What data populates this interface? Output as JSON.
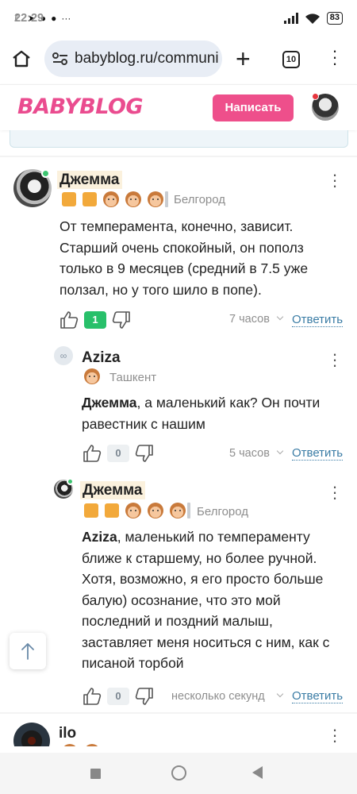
{
  "status_bar": {
    "time": "22:29",
    "battery": "83"
  },
  "browser": {
    "url": "babyblog.ru/communi",
    "tab_count": "10"
  },
  "site": {
    "logo": "BABYBLOG",
    "write_button": "Написать"
  },
  "comments": [
    {
      "name": "Джемма",
      "city": "Белгород",
      "text": "От темперамента, конечно, зависит. Старший очень спокойный, он пополз только в 9 месяцев (средний в 7.5 уже ползал, но у того шило в попе).",
      "votes": "1",
      "time": "7 часов",
      "reply": "Ответить"
    },
    {
      "name": "Aziza",
      "city": "Ташкент",
      "mention": "Джемма",
      "text": ", а маленький как? Он почти равестник с нашим",
      "votes": "0",
      "time": "5 часов",
      "reply": "Ответить"
    },
    {
      "name": "Джемма",
      "city": "Белгород",
      "mention": "Aziza",
      "text": ", маленький по темпераменту ближе к старшему, но более ручной. Хотя, возможно, я его просто больше балую) осознание, что это мой последний и поздний малыш, заставляет меня носиться с ним, как с писаной торбой",
      "votes": "0",
      "time": "несколько секунд",
      "reply": "Ответить"
    },
    {
      "name": "ilo"
    }
  ],
  "colors": {
    "accent": "#ee4f8b",
    "link": "#3a7ca5",
    "positive": "#28c06a",
    "badge": "#f2a93b"
  }
}
